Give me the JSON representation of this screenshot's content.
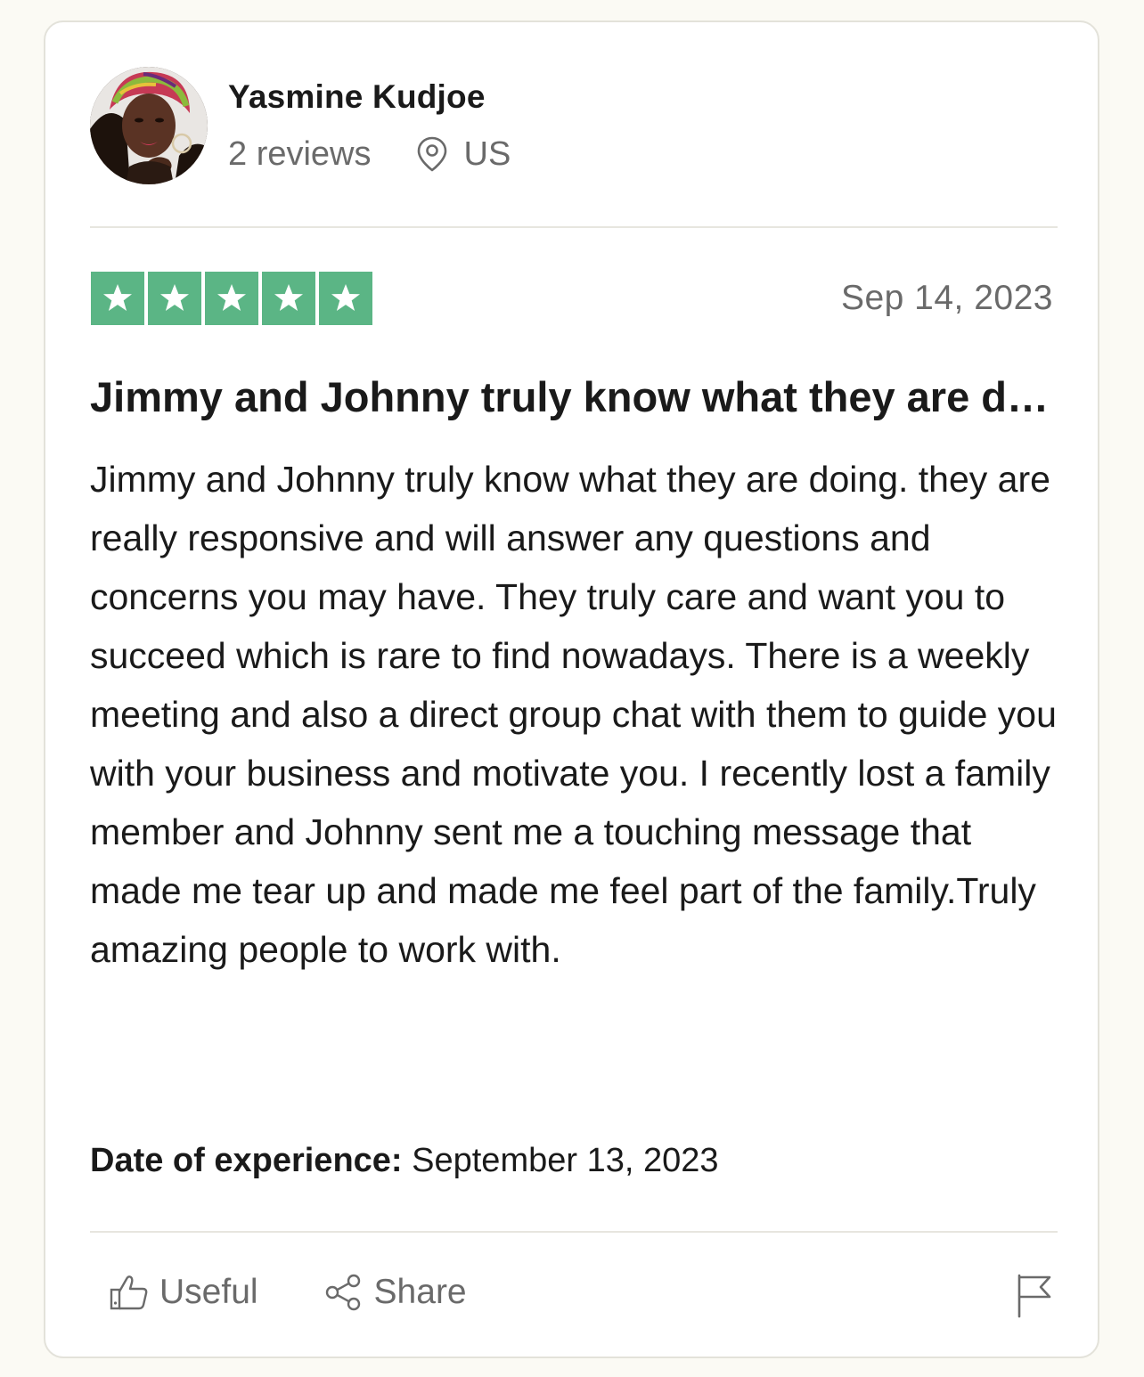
{
  "reviewer": {
    "name": "Yasmine Kudjoe",
    "reviews_count": "2 reviews",
    "location": "US",
    "location_icon": "location-pin-icon"
  },
  "review": {
    "rating": 5,
    "rating_max": 5,
    "star_color": "#5bb585",
    "date": "Sep 14, 2023",
    "title": "Jimmy and Johnny truly know what they are doing. they are really responsive and will answer any questions and concerns you may have.",
    "body": "Jimmy and Johnny truly know what they are doing. they are really responsive and will answer any questions and concerns you may have. They truly care and want you to succeed which is rare to find nowadays. There is a weekly meeting and also a direct group chat with them to guide you with your business and motivate you. I recently lost a family member and Johnny sent me a touching message that made me tear up and made me feel part of the family.Truly amazing people to work with.",
    "experience_label": "Date of experience:",
    "experience_date": "September 13, 2023"
  },
  "actions": {
    "useful_label": "Useful",
    "useful_icon": "thumbs-up-icon",
    "share_label": "Share",
    "share_icon": "share-icon",
    "flag_icon": "flag-icon"
  }
}
